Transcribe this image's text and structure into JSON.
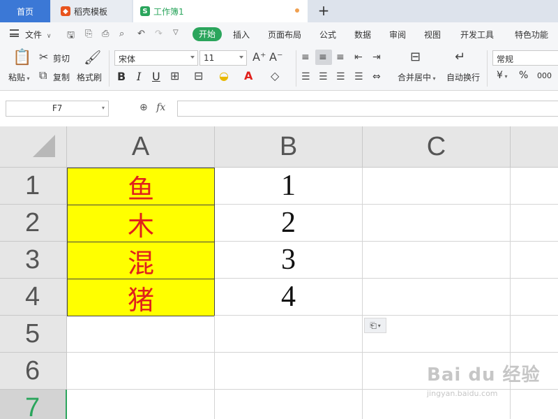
{
  "tabs": {
    "home": "首页",
    "templates": "稻壳模板",
    "workbook": "工作簿1",
    "workbook_icon": "S",
    "add": "+"
  },
  "menu": {
    "file": "文件",
    "items": [
      "开始",
      "插入",
      "页面布局",
      "公式",
      "数据",
      "审阅",
      "视图",
      "开发工具",
      "特色功能"
    ]
  },
  "ribbon": {
    "paste": "粘贴",
    "cut": "剪切",
    "copy": "复制",
    "format_painter": "格式刷",
    "font_name": "宋体",
    "font_size": "11",
    "bold": "B",
    "italic": "I",
    "underline": "U",
    "merge_center": "合并居中",
    "wrap_text": "自动换行",
    "number_format": "常规",
    "currency": "¥",
    "percent": "%",
    "thousands": "000"
  },
  "formula_bar": {
    "name_box": "F7",
    "fx": "fx",
    "formula": ""
  },
  "sheet": {
    "columns": [
      "A",
      "B",
      "C"
    ],
    "rows": [
      "1",
      "2",
      "3",
      "4",
      "5",
      "6",
      "7"
    ],
    "col_a": [
      "鱼",
      "木",
      "混",
      "猪"
    ],
    "col_b": [
      "1",
      "2",
      "3",
      "4"
    ]
  },
  "watermark": {
    "brand": "Bai du 经验",
    "url": "jingyan.baidu.com"
  },
  "colors": {
    "accent_green": "#2ba55c",
    "home_tab_blue": "#3b78d6",
    "cell_fill_yellow": "#ffff00",
    "cell_text_red": "#e0201c"
  }
}
